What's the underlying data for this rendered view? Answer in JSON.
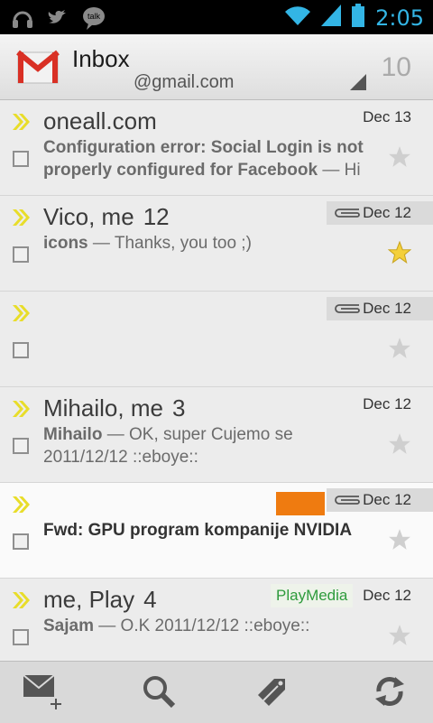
{
  "status_bar": {
    "left_icons": [
      "headphones-icon",
      "twitter-icon",
      "talk-icon"
    ],
    "talk_label": "talk",
    "right_icons": [
      "wifi-icon",
      "signal-icon",
      "battery-icon"
    ],
    "time": "2:05"
  },
  "header": {
    "title": "Inbox",
    "account": "@gmail.com",
    "unread_count": "10"
  },
  "emails": [
    {
      "sender": "oneall.com",
      "count": "",
      "subject": "Configuration error: Social Login is not properly configured for Facebook",
      "snippet": " — Hi",
      "date": "Dec 13",
      "attachment": false,
      "starred": false,
      "unread": false,
      "label": ""
    },
    {
      "sender": "Vico, me",
      "count": "12",
      "subject": "icons",
      "snippet": " — Thanks, you too ;)",
      "date": "Dec 12",
      "attachment": true,
      "starred": true,
      "unread": false,
      "label": ""
    },
    {
      "sender": "",
      "count": "",
      "subject": "",
      "snippet": "",
      "date": "Dec 12",
      "attachment": true,
      "starred": false,
      "unread": false,
      "label": ""
    },
    {
      "sender": "Mihailo, me",
      "count": "3",
      "subject": "Mihailo",
      "snippet": " — OK, super Cujemo se 2011/12/12 ::eboye::",
      "date": "Dec 12",
      "attachment": false,
      "starred": false,
      "unread": false,
      "label": ""
    },
    {
      "sender": "",
      "count": "",
      "subject": "Fwd: GPU program kompanije NVIDIA",
      "snippet": "",
      "date": "Dec 12",
      "attachment": true,
      "starred": false,
      "unread": true,
      "label": "orange"
    },
    {
      "sender": "me, Play",
      "count": "4",
      "subject": "Sajam",
      "snippet": " — O.K 2011/12/12 ::eboye::",
      "date": "Dec 12",
      "attachment": false,
      "starred": false,
      "unread": false,
      "label": "PlayMedia"
    }
  ],
  "bottom_bar": {
    "actions": [
      "compose-icon",
      "search-icon",
      "labels-icon",
      "refresh-icon"
    ]
  },
  "colors": {
    "accent_blue": "#33b5e5",
    "chevron_yellow": "#e8dd2a",
    "star_gold": "#f4d03a",
    "label_orange": "#ef7b10",
    "label_play_text": "#2e9b3c"
  }
}
